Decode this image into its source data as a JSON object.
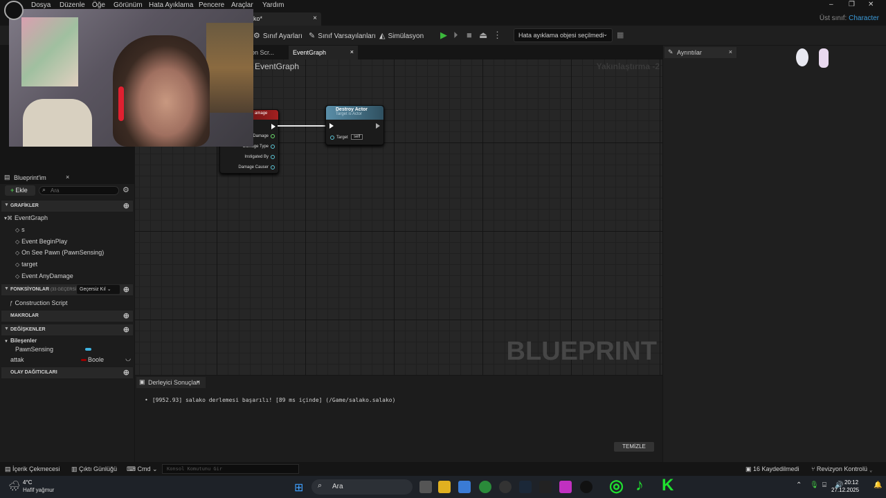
{
  "menu": [
    "Dosya",
    "Düzenle",
    "Öğe",
    "Görünüm",
    "Hata Ayıklama",
    "Pencere",
    "Araçlar",
    "Yardım"
  ],
  "window": {
    "minimize": "–",
    "restore": "❐",
    "close": "✕"
  },
  "document_tab": {
    "label": "ko*",
    "close": "×"
  },
  "parent_class": {
    "label": "Üst sınıf:",
    "value": "Character"
  },
  "toolbar": {
    "class_settings": "Sınıf Ayarları",
    "class_defaults": "Sınıf Varsayılanları",
    "simulation": "Simülasyon",
    "debug_object": "Hata ayıklama objesi seçilmedi"
  },
  "graph_tabs": [
    {
      "label": "on Scr...",
      "active": false
    },
    {
      "label": "EventGraph",
      "active": true
    }
  ],
  "graph": {
    "title": "EventGraph",
    "zoom": "Yakınlaştırma -2",
    "watermark": "BLUEPRINT",
    "event_node": {
      "title": "amage",
      "pins": [
        "Damage",
        "Damage Type",
        "Instigated By",
        "Damage Causer"
      ]
    },
    "destroy_node": {
      "title": "Destroy Actor",
      "subtitle": "Target is Actor",
      "target_label": "Target",
      "target_value": "self"
    }
  },
  "my_blueprint": {
    "title": "Blueprint'im",
    "add_label": "Ekle",
    "search_placeholder": "Ara",
    "sections": {
      "graphs": "GRAFİKLER",
      "functions": "FONKSİYONLAR",
      "functions_count": "(33 GEÇERSİ",
      "functions_filter": "Geçersiz Kıl",
      "macros": "MAKROLAR",
      "variables": "DEĞİŞKENLER",
      "dispatchers": "OLAY DAĞITICILARI"
    },
    "graph_items": [
      "EventGraph",
      "s",
      "Event BeginPlay",
      "On See Pawn (PawnSensing)",
      "target",
      "Event AnyDamage"
    ],
    "function_items": [
      "Construction Script"
    ],
    "components_label": "Bileşenler",
    "component_items": [
      "PawnSensing"
    ],
    "variables": [
      {
        "name": "attak",
        "type": "Boole",
        "color": "#9a0000"
      }
    ]
  },
  "details": {
    "title": "Ayrıntılar",
    "close": "×"
  },
  "compiler": {
    "title": "Derleyici Sonuçları",
    "close": "×",
    "log": "[9952.93] salako derlemesi başarılı! [89 ms içinde] (/Game/salako.salako)",
    "clear": "TEMİZLE"
  },
  "statusbar": {
    "content_drawer": "İçerik Çekmecesi",
    "output_log": "Çıktı Günlüğü",
    "cmd": "Cmd",
    "cmd_placeholder": "Konsol Komutunu Gir",
    "saved": "16 Kaydedilmedi",
    "revision": "Revizyon Kontrolü"
  },
  "taskbar": {
    "weather_temp": "4°C",
    "weather_desc": "Hafif yağmur",
    "search": "Ara",
    "time": "20:12",
    "date": "27.12.2025"
  },
  "colors": {
    "accent": "#3b9ad8",
    "play_green": "#3cb83c",
    "exec_white": "#ffffff",
    "pin_teal": "#5fc8d8"
  }
}
